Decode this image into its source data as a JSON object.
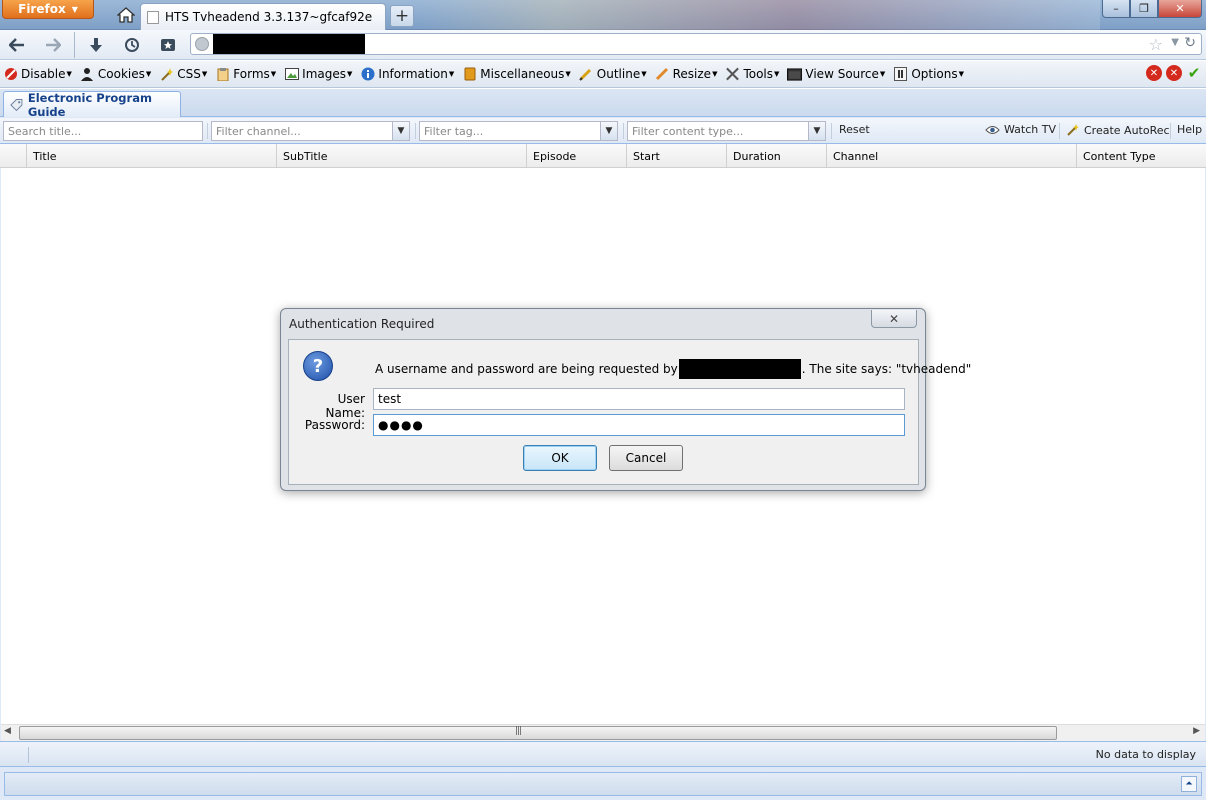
{
  "browser": {
    "menu_button": "Firefox",
    "tab_title": "HTS Tvheadend 3.3.137~gfcaf92e",
    "new_tab": "+",
    "window_buttons": [
      "–",
      "❐",
      "✕"
    ]
  },
  "navigation": {
    "icons": [
      "back-icon",
      "forward-icon",
      "downloads-icon",
      "history-icon",
      "bookmarks-icon"
    ]
  },
  "devtoolbar": {
    "items": [
      {
        "label": "Disable",
        "icon": "disable-icon"
      },
      {
        "label": "Cookies",
        "icon": "cookies-icon"
      },
      {
        "label": "CSS",
        "icon": "css-icon"
      },
      {
        "label": "Forms",
        "icon": "forms-icon"
      },
      {
        "label": "Images",
        "icon": "images-icon"
      },
      {
        "label": "Information",
        "icon": "information-icon"
      },
      {
        "label": "Miscellaneous",
        "icon": "miscellaneous-icon"
      },
      {
        "label": "Outline",
        "icon": "outline-icon"
      },
      {
        "label": "Resize",
        "icon": "resize-icon"
      },
      {
        "label": "Tools",
        "icon": "tools-icon"
      },
      {
        "label": "View Source",
        "icon": "view-source-icon"
      },
      {
        "label": "Options",
        "icon": "options-icon"
      }
    ],
    "status_colors": {
      "error": "#d42a1e",
      "ok": "#3aa312"
    }
  },
  "app": {
    "tab_label": "Electronic Program Guide",
    "filters": {
      "title_placeholder": "Search title...",
      "channel_placeholder": "Filter channel...",
      "tag_placeholder": "Filter tag...",
      "content_type_placeholder": "Filter content type...",
      "reset": "Reset",
      "watch_tv": "Watch TV",
      "create_autorec": "Create AutoRec",
      "help": "Help"
    },
    "columns": [
      "Title",
      "SubTitle",
      "Episode",
      "Start",
      "Duration",
      "Channel",
      "Content Type"
    ],
    "paging_status": "No data to display",
    "colors": {
      "accent": "#15428b",
      "border": "#99bbe8"
    }
  },
  "dialog": {
    "title": "Authentication Required",
    "close": "✕",
    "message_before": "A username and password are being requested by",
    "message_after": ". The site says: \"tvheadend\"",
    "username_label": "User Name:",
    "username_value": "test",
    "password_label": "Password:",
    "password_value": "●●●●",
    "ok": "OK",
    "cancel": "Cancel"
  }
}
